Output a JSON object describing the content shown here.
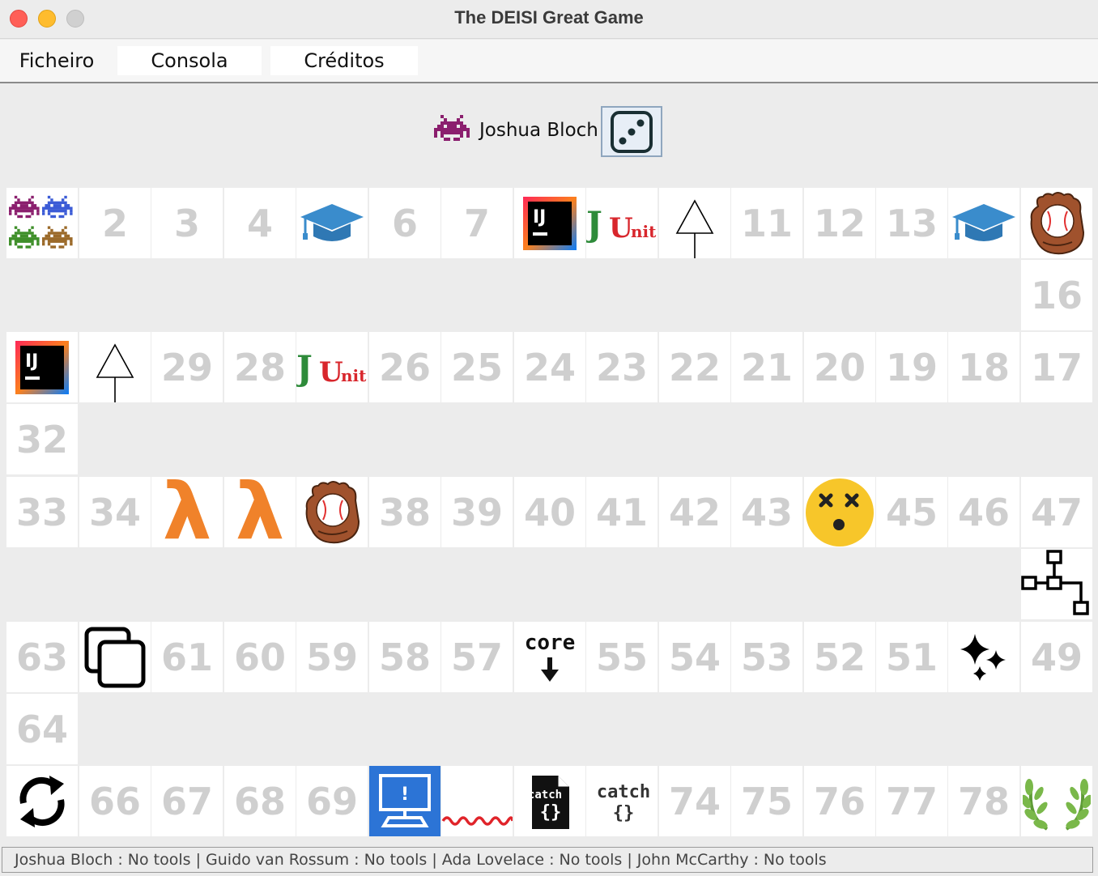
{
  "window": {
    "title": "The DEISI Great Game"
  },
  "menu": {
    "items": [
      "Ficheiro",
      "Consola",
      "Créditos"
    ]
  },
  "current_player": {
    "name": "Joshua Bloch",
    "avatar": "purple-invader-icon",
    "dice_icon": "dice-three-icon"
  },
  "board": {
    "cells": {
      "c1": {
        "type": "icon",
        "icon": "players-group-icon"
      },
      "c2": {
        "type": "number",
        "label": "2"
      },
      "c3": {
        "type": "number",
        "label": "3"
      },
      "c4": {
        "type": "number",
        "label": "4"
      },
      "c5": {
        "type": "icon",
        "icon": "graduation-cap-icon"
      },
      "c6": {
        "type": "number",
        "label": "6"
      },
      "c7": {
        "type": "number",
        "label": "7"
      },
      "c8": {
        "type": "icon",
        "icon": "intellij-icon",
        "text": "IJ"
      },
      "c9": {
        "type": "icon",
        "icon": "junit-icon",
        "text": "JUnit"
      },
      "c10": {
        "type": "icon",
        "icon": "inheritance-arrow-icon"
      },
      "c11": {
        "type": "number",
        "label": "11"
      },
      "c12": {
        "type": "number",
        "label": "12"
      },
      "c13": {
        "type": "number",
        "label": "13"
      },
      "c14": {
        "type": "icon",
        "icon": "graduation-cap-icon"
      },
      "c15": {
        "type": "icon",
        "icon": "baseball-glove-icon"
      },
      "c16": {
        "type": "number",
        "label": "16"
      },
      "c17": {
        "type": "number",
        "label": "17"
      },
      "c18": {
        "type": "number",
        "label": "18"
      },
      "c19": {
        "type": "number",
        "label": "19"
      },
      "c20": {
        "type": "number",
        "label": "20"
      },
      "c21": {
        "type": "number",
        "label": "21"
      },
      "c22": {
        "type": "number",
        "label": "22"
      },
      "c23": {
        "type": "number",
        "label": "23"
      },
      "c24": {
        "type": "number",
        "label": "24"
      },
      "c25": {
        "type": "number",
        "label": "25"
      },
      "c26": {
        "type": "number",
        "label": "26"
      },
      "c27": {
        "type": "icon",
        "icon": "junit-icon",
        "text": "JUnit"
      },
      "c28": {
        "type": "number",
        "label": "28"
      },
      "c29": {
        "type": "number",
        "label": "29"
      },
      "c30": {
        "type": "icon",
        "icon": "inheritance-arrow-icon"
      },
      "c31": {
        "type": "icon",
        "icon": "intellij-icon",
        "text": "IJ"
      },
      "c32": {
        "type": "number",
        "label": "32"
      },
      "c33": {
        "type": "number",
        "label": "33"
      },
      "c34": {
        "type": "number",
        "label": "34"
      },
      "c35": {
        "type": "icon",
        "icon": "lambda-icon",
        "text": "λ"
      },
      "c36": {
        "type": "icon",
        "icon": "lambda-icon",
        "text": "λ"
      },
      "c37": {
        "type": "icon",
        "icon": "baseball-glove-icon"
      },
      "c38": {
        "type": "number",
        "label": "38"
      },
      "c39": {
        "type": "number",
        "label": "39"
      },
      "c40": {
        "type": "number",
        "label": "40"
      },
      "c41": {
        "type": "number",
        "label": "41"
      },
      "c42": {
        "type": "number",
        "label": "42"
      },
      "c43": {
        "type": "number",
        "label": "43"
      },
      "c44": {
        "type": "icon",
        "icon": "dizzy-face-icon"
      },
      "c45": {
        "type": "number",
        "label": "45"
      },
      "c46": {
        "type": "number",
        "label": "46"
      },
      "c47": {
        "type": "number",
        "label": "47"
      },
      "c48": {
        "type": "icon",
        "icon": "tree-structure-icon"
      },
      "c49": {
        "type": "number",
        "label": "49"
      },
      "c50": {
        "type": "icon",
        "icon": "sparkles-icon"
      },
      "c51": {
        "type": "number",
        "label": "51"
      },
      "c52": {
        "type": "number",
        "label": "52"
      },
      "c53": {
        "type": "number",
        "label": "53"
      },
      "c54": {
        "type": "number",
        "label": "54"
      },
      "c55": {
        "type": "number",
        "label": "55"
      },
      "c56": {
        "type": "icon",
        "icon": "core-dump-icon",
        "text": "core"
      },
      "c57": {
        "type": "number",
        "label": "57"
      },
      "c58": {
        "type": "number",
        "label": "58"
      },
      "c59": {
        "type": "number",
        "label": "59"
      },
      "c60": {
        "type": "number",
        "label": "60"
      },
      "c61": {
        "type": "number",
        "label": "61"
      },
      "c62": {
        "type": "icon",
        "icon": "duplicate-icon"
      },
      "c63": {
        "type": "number",
        "label": "63"
      },
      "c64": {
        "type": "number",
        "label": "64"
      },
      "c65": {
        "type": "icon",
        "icon": "infinite-loop-icon"
      },
      "c66": {
        "type": "number",
        "label": "66"
      },
      "c67": {
        "type": "number",
        "label": "67"
      },
      "c68": {
        "type": "number",
        "label": "68"
      },
      "c69": {
        "type": "number",
        "label": "69"
      },
      "c70": {
        "type": "icon",
        "icon": "blue-screen-icon",
        "text": "!"
      },
      "c71": {
        "type": "icon",
        "icon": "syntax-error-squiggle-icon"
      },
      "c72": {
        "type": "icon",
        "icon": "catch-file-icon",
        "text": "catch"
      },
      "c73": {
        "type": "icon",
        "icon": "catch-block-icon",
        "text": "catch"
      },
      "c74": {
        "type": "number",
        "label": "74"
      },
      "c75": {
        "type": "number",
        "label": "75"
      },
      "c76": {
        "type": "number",
        "label": "76"
      },
      "c77": {
        "type": "number",
        "label": "77"
      },
      "c78": {
        "type": "number",
        "label": "78"
      },
      "c79": {
        "type": "icon",
        "icon": "laurel-wreath-icon"
      }
    }
  },
  "status": {
    "text": "Joshua Bloch : No tools | Guido van Rossum : No tools | Ada Lovelace : No tools | John McCarthy : No tools"
  },
  "colors": {
    "purple": "#8b1f6e",
    "blue": "#3b5bd6",
    "green": "#3f8f2a",
    "brown": "#9b6a2a",
    "lambda": "#f0822a",
    "cap": "#3a8ccc",
    "junit_green": "#2e8b3a",
    "junit_red": "#d8262c",
    "emoji": "#f7c62a",
    "win_blue": "#2c74d6"
  }
}
